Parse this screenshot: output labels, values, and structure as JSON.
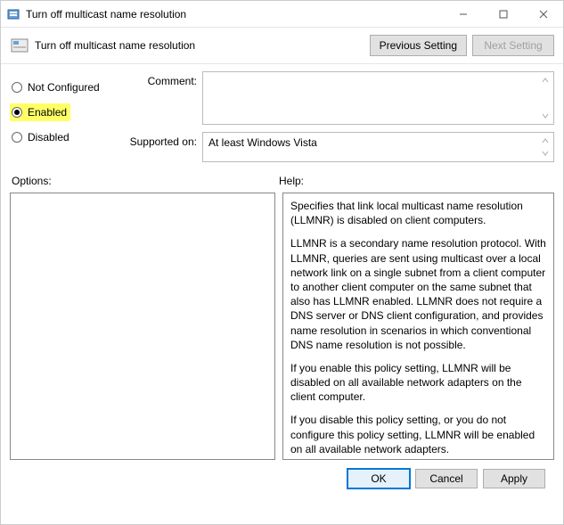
{
  "window": {
    "title": "Turn off multicast name resolution"
  },
  "header": {
    "heading": "Turn off multicast name resolution",
    "previous_setting": "Previous Setting",
    "next_setting": "Next Setting"
  },
  "state": {
    "not_configured": "Not Configured",
    "enabled": "Enabled",
    "disabled": "Disabled",
    "selected": "enabled"
  },
  "fields": {
    "comment_label": "Comment:",
    "comment_value": "",
    "supported_label": "Supported on:",
    "supported_value": "At least Windows Vista"
  },
  "sections": {
    "options_label": "Options:",
    "help_label": "Help:"
  },
  "help": {
    "p1": "Specifies that link local multicast name resolution (LLMNR) is disabled on client computers.",
    "p2": "LLMNR is a secondary name resolution protocol. With LLMNR, queries are sent using multicast over a local network link on a single subnet from a client computer to another client computer on the same subnet that also has LLMNR enabled. LLMNR does not require a DNS server or DNS client configuration, and provides name resolution in scenarios in which conventional DNS name resolution is not possible.",
    "p3": "If you enable this policy setting, LLMNR will be disabled on all available network adapters on the client computer.",
    "p4": "If you disable this policy setting, or you do not configure this policy setting, LLMNR will be enabled on all available network adapters."
  },
  "footer": {
    "ok": "OK",
    "cancel": "Cancel",
    "apply": "Apply"
  }
}
